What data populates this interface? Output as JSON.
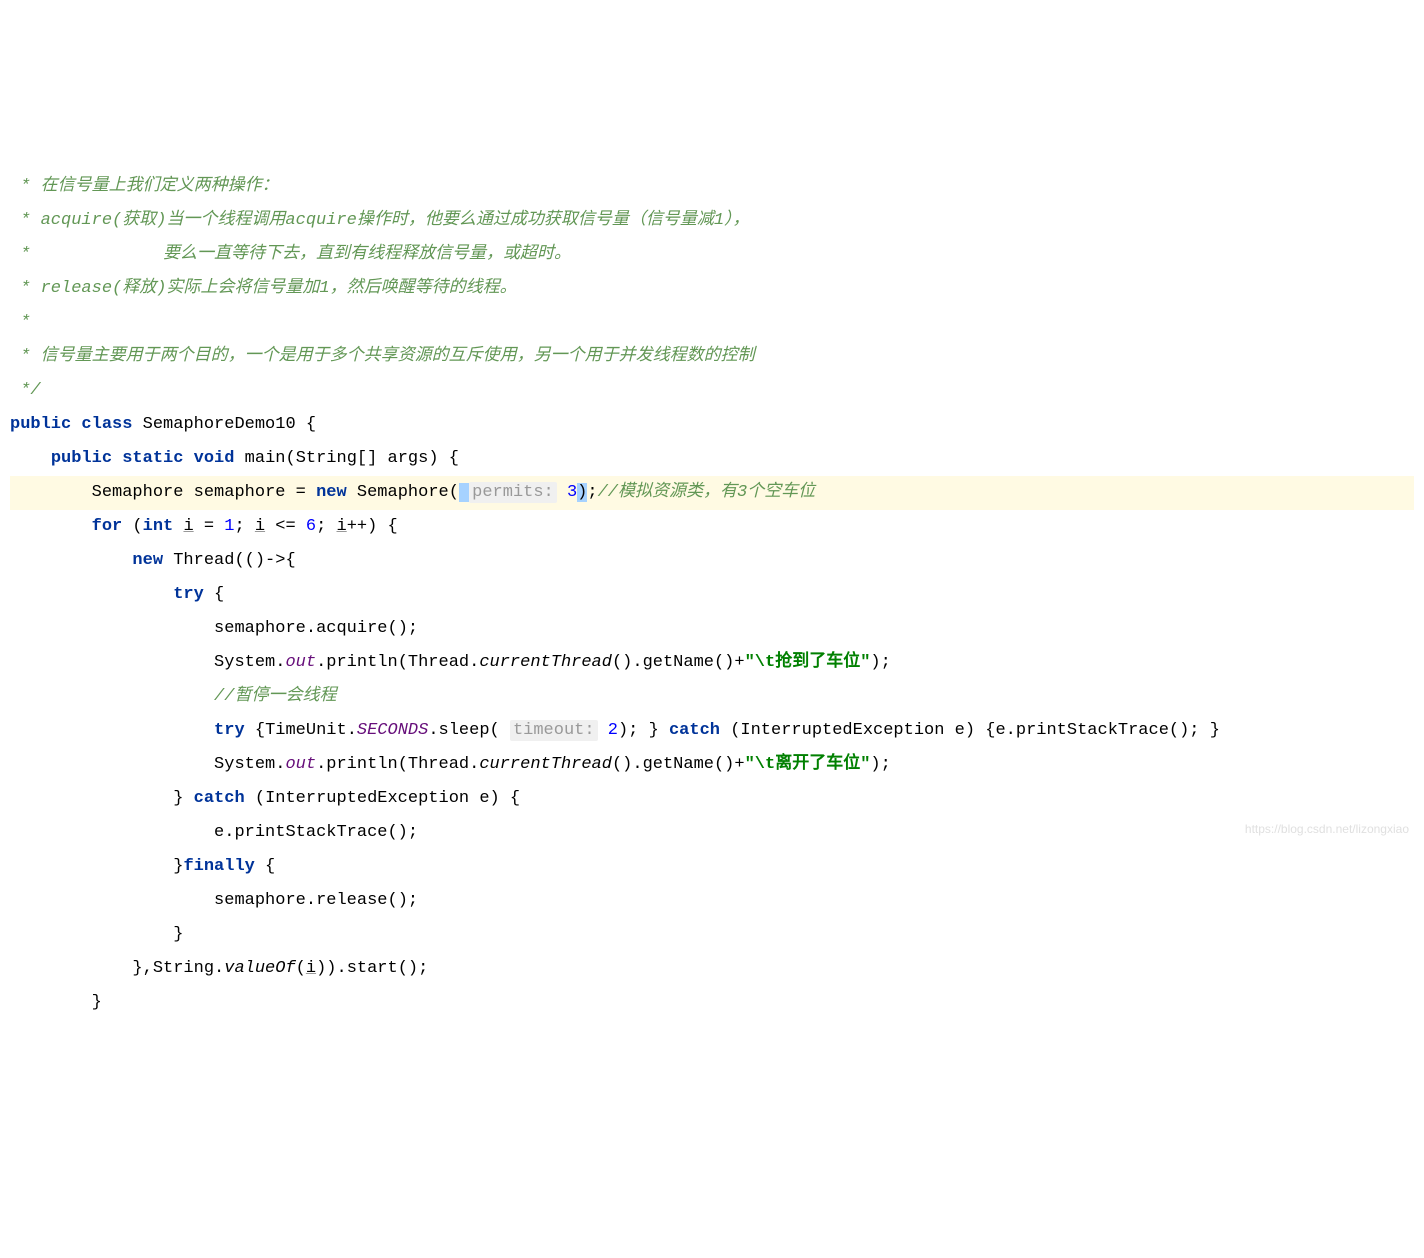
{
  "comments": {
    "line1": " * 在信号量上我们定义两种操作：",
    "line2": " * acquire(获取)当一个线程调用acquire操作时，他要么通过成功获取信号量（信号量减1），",
    "line3": " *             要么一直等待下去，直到有线程释放信号量，或超时。",
    "line4": " * release(释放)实际上会将信号量加1，然后唤醒等待的线程。",
    "line5": " *",
    "line6": " * 信号量主要用于两个目的，一个是用于多个共享资源的互斥使用，另一个用于并发线程数的控制",
    "line7": " */",
    "inline1": "//模拟资源类，有3个空车位",
    "inline2": "//暂停一会线程"
  },
  "keywords": {
    "public": "public",
    "class": "class",
    "static": "static",
    "void": "void",
    "new": "new",
    "for": "for",
    "int": "int",
    "try": "try",
    "catch": "catch",
    "finally": "finally"
  },
  "identifiers": {
    "className": "SemaphoreDemo10",
    "mainMethod": "main",
    "stringArr": "String[]",
    "args": "args",
    "semaphoreType": "Semaphore",
    "semaphoreVar": "semaphore",
    "i": "i",
    "thread": "Thread",
    "system": "System",
    "out": "out",
    "println": "println",
    "currentThread": "currentThread",
    "getName": "getName",
    "acquire": "acquire",
    "release": "release",
    "timeUnit": "TimeUnit",
    "seconds": "SECONDS",
    "sleep": "sleep",
    "interruptedException": "InterruptedException",
    "e": "e",
    "printStackTrace": "printStackTrace",
    "stringClass": "String",
    "valueOf": "valueOf",
    "start": "start"
  },
  "paramHints": {
    "permits": "permits:",
    "timeout": "timeout:"
  },
  "values": {
    "permitsVal": "3",
    "loopStart": "1",
    "loopEnd": "6",
    "timeoutVal": "2"
  },
  "strings": {
    "tab1": "\"\\t抢到了车位\"",
    "tab2": "\"\\t离开了车位\""
  },
  "watermark": "https://blog.csdn.net/lizongxiao"
}
